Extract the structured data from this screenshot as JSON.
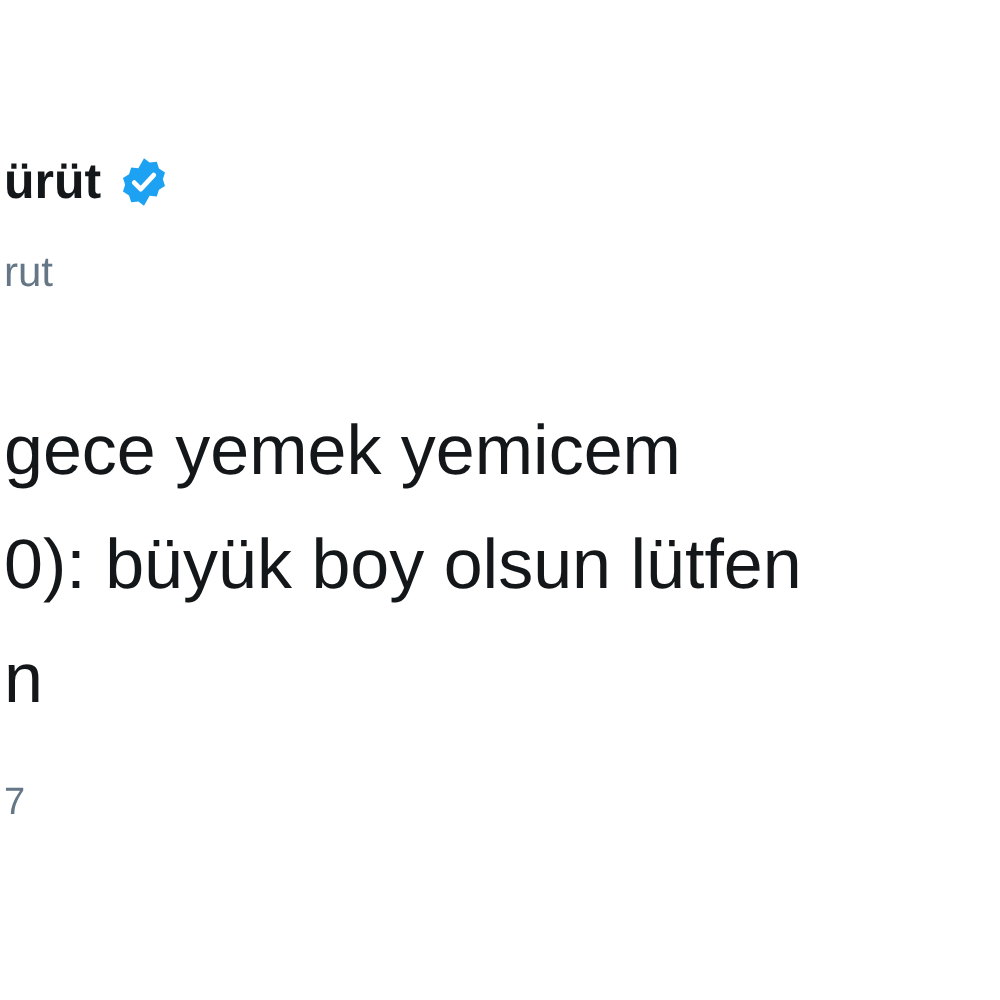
{
  "author": {
    "name": "ürüt",
    "verified": true,
    "handle": "rut"
  },
  "tweet_lines": [
    "gece yemek yemicem",
    "0): büyük boy olsun lütfen",
    "n"
  ],
  "timestamp": "7"
}
